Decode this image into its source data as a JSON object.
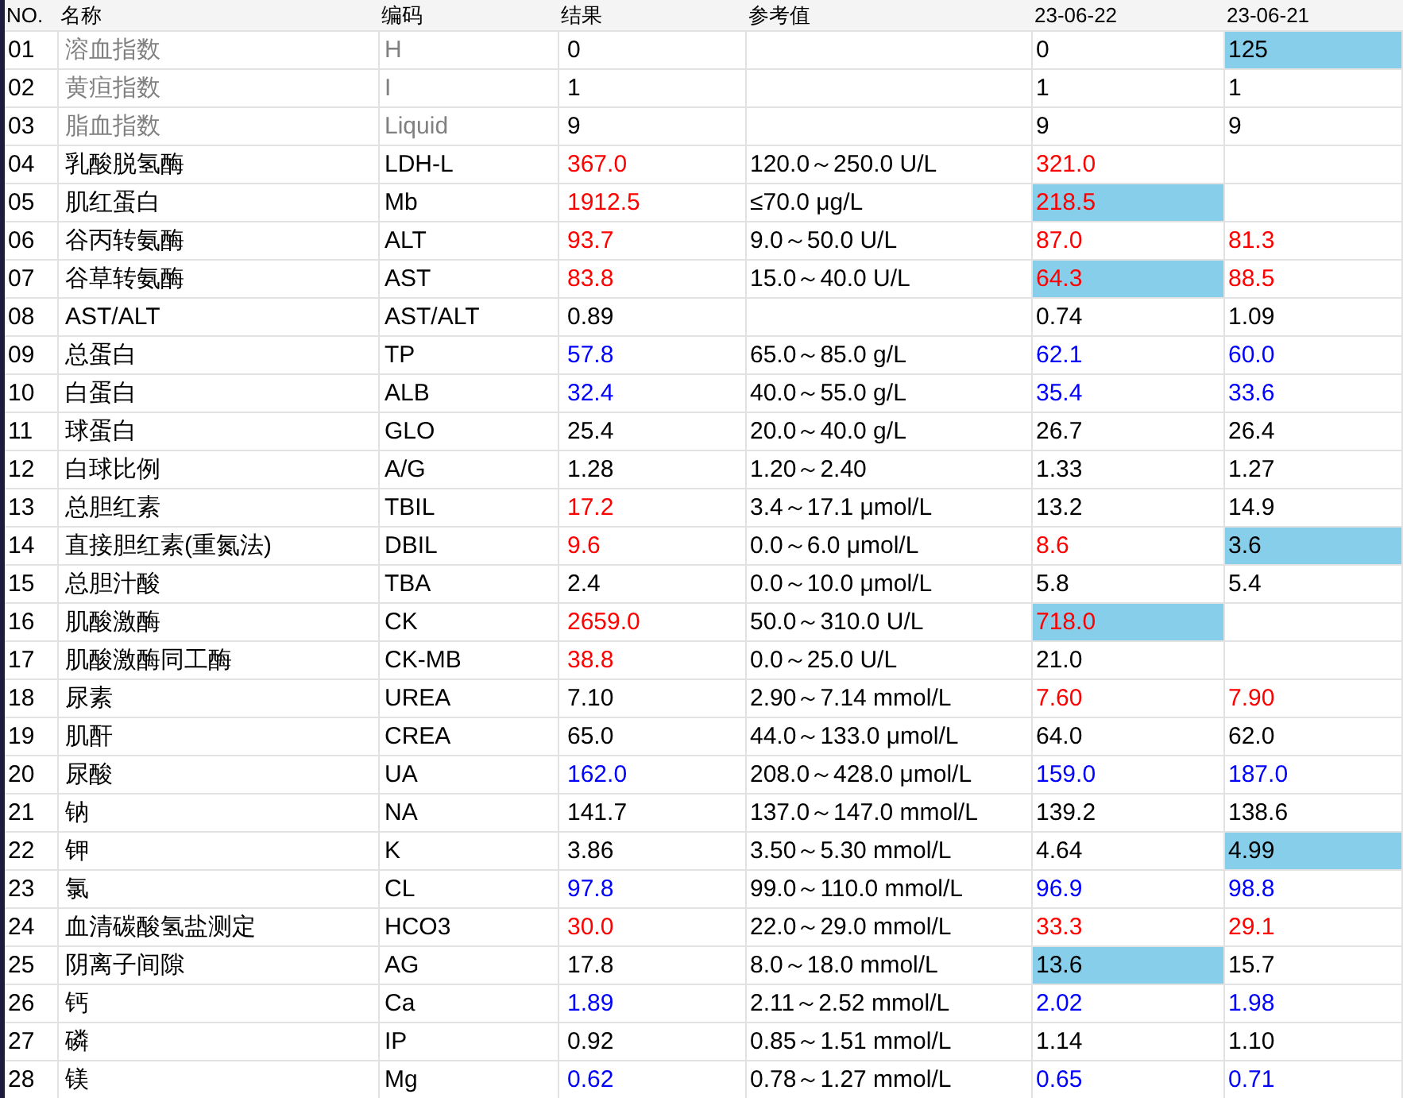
{
  "columns": [
    "NO.",
    "名称",
    "编码",
    "结果",
    "参考值",
    "23-06-22",
    "23-06-21"
  ],
  "rows": [
    {
      "no": "01",
      "name": "溶血指数",
      "code": "H",
      "dimmed": true,
      "result": {
        "text": "0",
        "high": false,
        "low": false
      },
      "history": [
        {
          "text": "0",
          "high": false,
          "low": false,
          "highlighted": false
        },
        {
          "text": "125",
          "high": false,
          "low": false,
          "highlighted": true
        }
      ]
    },
    {
      "no": "02",
      "name": "黄疸指数",
      "code": "I",
      "dimmed": true,
      "result": {
        "text": "1",
        "high": false,
        "low": false
      },
      "history": [
        {
          "text": "1",
          "high": false,
          "low": false,
          "highlighted": false
        },
        {
          "text": "1",
          "high": false,
          "low": false,
          "highlighted": false
        }
      ]
    },
    {
      "no": "03",
      "name": "脂血指数",
      "code": "Liquid",
      "dimmed": true,
      "result": {
        "text": "9",
        "high": false,
        "low": false
      },
      "history": [
        {
          "text": "9",
          "high": false,
          "low": false,
          "highlighted": false
        },
        {
          "text": "9",
          "high": false,
          "low": false,
          "highlighted": false
        }
      ]
    },
    {
      "no": "04",
      "name": "乳酸脱氢酶",
      "code": "LDH-L",
      "dimmed": false,
      "result": {
        "text": "367.0",
        "high": true,
        "low": false
      },
      "reference": "120.0～250.0 U/L",
      "history": [
        {
          "text": "321.0",
          "high": true,
          "low": false,
          "highlighted": false
        },
        {
          "highlighted": false
        }
      ]
    },
    {
      "no": "05",
      "name": "肌红蛋白",
      "code": "Mb",
      "dimmed": false,
      "result": {
        "text": "1912.5",
        "high": true,
        "low": false
      },
      "reference": "≤70.0 μg/L",
      "history": [
        {
          "text": "218.5",
          "high": true,
          "low": false,
          "highlighted": true
        },
        {
          "highlighted": false
        }
      ]
    },
    {
      "no": "06",
      "name": "谷丙转氨酶",
      "code": "ALT",
      "dimmed": false,
      "result": {
        "text": "93.7",
        "high": true,
        "low": false
      },
      "reference": "9.0～50.0 U/L",
      "history": [
        {
          "text": "87.0",
          "high": true,
          "low": false,
          "highlighted": false
        },
        {
          "text": "81.3",
          "high": true,
          "low": false,
          "highlighted": false
        }
      ]
    },
    {
      "no": "07",
      "name": "谷草转氨酶",
      "code": "AST",
      "dimmed": false,
      "result": {
        "text": "83.8",
        "high": true,
        "low": false
      },
      "reference": "15.0～40.0 U/L",
      "history": [
        {
          "text": "64.3",
          "high": true,
          "low": false,
          "highlighted": true
        },
        {
          "text": "88.5",
          "high": true,
          "low": false,
          "highlighted": false
        }
      ]
    },
    {
      "no": "08",
      "name": "AST/ALT",
      "code": "AST/ALT",
      "dimmed": false,
      "result": {
        "text": "0.89",
        "high": false,
        "low": false
      },
      "history": [
        {
          "text": "0.74",
          "high": false,
          "low": false,
          "highlighted": false
        },
        {
          "text": "1.09",
          "high": false,
          "low": false,
          "highlighted": false
        }
      ]
    },
    {
      "no": "09",
      "name": "总蛋白",
      "code": "TP",
      "dimmed": false,
      "result": {
        "text": "57.8",
        "high": false,
        "low": true
      },
      "reference": "65.0～85.0 g/L",
      "history": [
        {
          "text": "62.1",
          "high": false,
          "low": true,
          "highlighted": false
        },
        {
          "text": "60.0",
          "high": false,
          "low": true,
          "highlighted": false
        }
      ]
    },
    {
      "no": "10",
      "name": "白蛋白",
      "code": "ALB",
      "dimmed": false,
      "result": {
        "text": "32.4",
        "high": false,
        "low": true
      },
      "reference": "40.0～55.0 g/L",
      "history": [
        {
          "text": "35.4",
          "high": false,
          "low": true,
          "highlighted": false
        },
        {
          "text": "33.6",
          "high": false,
          "low": true,
          "highlighted": false
        }
      ]
    },
    {
      "no": "11",
      "name": "球蛋白",
      "code": "GLO",
      "dimmed": false,
      "result": {
        "text": "25.4",
        "high": false,
        "low": false
      },
      "reference": "20.0～40.0 g/L",
      "history": [
        {
          "text": "26.7",
          "high": false,
          "low": false,
          "highlighted": false
        },
        {
          "text": "26.4",
          "high": false,
          "low": false,
          "highlighted": false
        }
      ]
    },
    {
      "no": "12",
      "name": "白球比例",
      "code": "A/G",
      "dimmed": false,
      "result": {
        "text": "1.28",
        "high": false,
        "low": false
      },
      "reference": "1.20～2.40",
      "history": [
        {
          "text": "1.33",
          "high": false,
          "low": false,
          "highlighted": false
        },
        {
          "text": "1.27",
          "high": false,
          "low": false,
          "highlighted": false
        }
      ]
    },
    {
      "no": "13",
      "name": "总胆红素",
      "code": "TBIL",
      "dimmed": false,
      "result": {
        "text": "17.2",
        "high": true,
        "low": false
      },
      "reference": "3.4～17.1 μmol/L",
      "history": [
        {
          "text": "13.2",
          "high": false,
          "low": false,
          "highlighted": false
        },
        {
          "text": "14.9",
          "high": false,
          "low": false,
          "highlighted": false
        }
      ]
    },
    {
      "no": "14",
      "name": "直接胆红素(重氮法)",
      "code": "DBIL",
      "dimmed": false,
      "result": {
        "text": "9.6",
        "high": true,
        "low": false
      },
      "reference": "0.0～6.0 μmol/L",
      "history": [
        {
          "text": "8.6",
          "high": true,
          "low": false,
          "highlighted": false
        },
        {
          "text": "3.6",
          "high": false,
          "low": false,
          "highlighted": true
        }
      ]
    },
    {
      "no": "15",
      "name": "总胆汁酸",
      "code": "TBA",
      "dimmed": false,
      "result": {
        "text": "2.4",
        "high": false,
        "low": false
      },
      "reference": "0.0～10.0 μmol/L",
      "history": [
        {
          "text": "5.8",
          "high": false,
          "low": false,
          "highlighted": false
        },
        {
          "text": "5.4",
          "high": false,
          "low": false,
          "highlighted": false
        }
      ]
    },
    {
      "no": "16",
      "name": "肌酸激酶",
      "code": "CK",
      "dimmed": false,
      "result": {
        "text": "2659.0",
        "high": true,
        "low": false
      },
      "reference": "50.0～310.0 U/L",
      "history": [
        {
          "text": "718.0",
          "high": true,
          "low": false,
          "highlighted": true
        },
        {
          "highlighted": false
        }
      ]
    },
    {
      "no": "17",
      "name": "肌酸激酶同工酶",
      "code": "CK-MB",
      "dimmed": false,
      "result": {
        "text": "38.8",
        "high": true,
        "low": false
      },
      "reference": "0.0～25.0 U/L",
      "history": [
        {
          "text": "21.0",
          "high": false,
          "low": false,
          "highlighted": false
        },
        {
          "highlighted": false
        }
      ]
    },
    {
      "no": "18",
      "name": "尿素",
      "code": "UREA",
      "dimmed": false,
      "result": {
        "text": "7.10",
        "high": false,
        "low": false
      },
      "reference": "2.90～7.14 mmol/L",
      "history": [
        {
          "text": "7.60",
          "high": true,
          "low": false,
          "highlighted": false
        },
        {
          "text": "7.90",
          "high": true,
          "low": false,
          "highlighted": false
        }
      ]
    },
    {
      "no": "19",
      "name": "肌酐",
      "code": "CREA",
      "dimmed": false,
      "result": {
        "text": "65.0",
        "high": false,
        "low": false
      },
      "reference": "44.0～133.0 μmol/L",
      "history": [
        {
          "text": "64.0",
          "high": false,
          "low": false,
          "highlighted": false
        },
        {
          "text": "62.0",
          "high": false,
          "low": false,
          "highlighted": false
        }
      ]
    },
    {
      "no": "20",
      "name": "尿酸",
      "code": "UA",
      "dimmed": false,
      "result": {
        "text": "162.0",
        "high": false,
        "low": true
      },
      "reference": "208.0～428.0 μmol/L",
      "history": [
        {
          "text": "159.0",
          "high": false,
          "low": true,
          "highlighted": false
        },
        {
          "text": "187.0",
          "high": false,
          "low": true,
          "highlighted": false
        }
      ]
    },
    {
      "no": "21",
      "name": "钠",
      "code": "NA",
      "dimmed": false,
      "result": {
        "text": "141.7",
        "high": false,
        "low": false
      },
      "reference": "137.0～147.0 mmol/L",
      "history": [
        {
          "text": "139.2",
          "high": false,
          "low": false,
          "highlighted": false
        },
        {
          "text": "138.6",
          "high": false,
          "low": false,
          "highlighted": false
        }
      ]
    },
    {
      "no": "22",
      "name": "钾",
      "code": "K",
      "dimmed": false,
      "result": {
        "text": "3.86",
        "high": false,
        "low": false
      },
      "reference": "3.50～5.30 mmol/L",
      "history": [
        {
          "text": "4.64",
          "high": false,
          "low": false,
          "highlighted": false
        },
        {
          "text": "4.99",
          "high": false,
          "low": false,
          "highlighted": true
        }
      ]
    },
    {
      "no": "23",
      "name": "氯",
      "code": "CL",
      "dimmed": false,
      "result": {
        "text": "97.8",
        "high": false,
        "low": true
      },
      "reference": "99.0～110.0 mmol/L",
      "history": [
        {
          "text": "96.9",
          "high": false,
          "low": true,
          "highlighted": false
        },
        {
          "text": "98.8",
          "high": false,
          "low": true,
          "highlighted": false
        }
      ]
    },
    {
      "no": "24",
      "name": "血清碳酸氢盐测定",
      "code": "HCO3",
      "dimmed": false,
      "result": {
        "text": "30.0",
        "high": true,
        "low": false
      },
      "reference": "22.0～29.0 mmol/L",
      "history": [
        {
          "text": "33.3",
          "high": true,
          "low": false,
          "highlighted": false
        },
        {
          "text": "29.1",
          "high": true,
          "low": false,
          "highlighted": false
        }
      ]
    },
    {
      "no": "25",
      "name": "阴离子间隙",
      "code": "AG",
      "dimmed": false,
      "result": {
        "text": "17.8",
        "high": false,
        "low": false
      },
      "reference": "8.0～18.0 mmol/L",
      "history": [
        {
          "text": "13.6",
          "high": false,
          "low": false,
          "highlighted": true
        },
        {
          "text": "15.7",
          "high": false,
          "low": false,
          "highlighted": false
        }
      ]
    },
    {
      "no": "26",
      "name": "钙",
      "code": "Ca",
      "dimmed": false,
      "result": {
        "text": "1.89",
        "high": false,
        "low": true
      },
      "reference": "2.11～2.52 mmol/L",
      "history": [
        {
          "text": "2.02",
          "high": false,
          "low": true,
          "highlighted": false
        },
        {
          "text": "1.98",
          "high": false,
          "low": true,
          "highlighted": false
        }
      ]
    },
    {
      "no": "27",
      "name": "磷",
      "code": "IP",
      "dimmed": false,
      "result": {
        "text": "0.92",
        "high": false,
        "low": false
      },
      "reference": "0.85～1.51 mmol/L",
      "history": [
        {
          "text": "1.14",
          "high": false,
          "low": false,
          "highlighted": false
        },
        {
          "text": "1.10",
          "high": false,
          "low": false,
          "highlighted": false
        }
      ]
    },
    {
      "no": "28",
      "name": "镁",
      "code": "Mg",
      "dimmed": false,
      "result": {
        "text": "0.62",
        "high": false,
        "low": true
      },
      "reference": "0.78～1.27 mmol/L",
      "history": [
        {
          "text": "0.65",
          "high": false,
          "low": true,
          "highlighted": false
        },
        {
          "text": "0.71",
          "high": false,
          "low": true,
          "highlighted": false
        }
      ]
    }
  ]
}
